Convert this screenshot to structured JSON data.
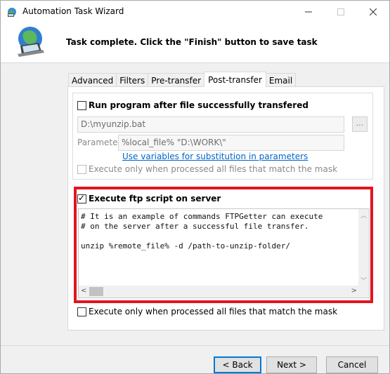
{
  "window": {
    "title": "Automation Task Wizard"
  },
  "header": {
    "message": "Task complete. Click the \"Finish\" button to save task"
  },
  "tabs": [
    {
      "label": "Advanced",
      "active": false
    },
    {
      "label": "Filters",
      "active": false
    },
    {
      "label": "Pre-transfer",
      "active": false
    },
    {
      "label": "Post-transfer",
      "active": true
    },
    {
      "label": "Email",
      "active": false
    }
  ],
  "run_program": {
    "label": "Run program after file successfully transfered",
    "checked": false,
    "program_path": "D:\\myunzip.bat",
    "browse_label": "...",
    "parameters_label": "Parameters",
    "parameters_value": "%local_file% \"D:\\WORK\\\"",
    "variables_link": "Use variables for substitution in parameters",
    "execute_when_all_label": "Execute only when processed all files that match the mask",
    "execute_when_all_checked": false
  },
  "ftp_script": {
    "label": "Execute ftp script on server",
    "checked": true,
    "script_lines": [
      "# It is an example of commands FTPGetter can execute",
      "# on the server after a successful file transfer.",
      "",
      "unzip %remote_file% -d /path-to-unzip-folder/"
    ]
  },
  "execute_when_all_bottom": {
    "label": "Execute only when processed all files that match the mask",
    "checked": false
  },
  "buttons": {
    "back": "< Back",
    "next": "Next >",
    "cancel": "Cancel"
  },
  "colors": {
    "highlight": "#e0161f",
    "link": "#0066cc",
    "focus": "#0078d7"
  }
}
